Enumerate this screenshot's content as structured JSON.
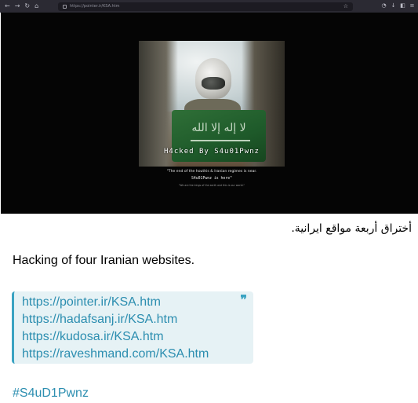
{
  "browser": {
    "url": "https://pointer.ir/KSA.htm",
    "icons": [
      "back-icon",
      "forward-icon",
      "reload-icon",
      "home-icon",
      "bookmark-star-icon",
      "extensions-icon",
      "menu-icon"
    ]
  },
  "screenshot": {
    "hero_text": "H4cked By S4u01Pwnz",
    "caption_line1": "\"The end of the houthis & Iranian regimes is near.",
    "caption_line2": "S4u01Pwnz is here\"",
    "caption_line3": "\"We are the kings of the earth and this is our world.\""
  },
  "message": {
    "arabic_text": "أختراق أربعة مواقع ايرانية.",
    "english_text": "Hacking of four Iranian websites.",
    "quote_links": [
      "https://pointer.ir/KSA.htm",
      "https://hadafsanj.ir/KSA.htm",
      "https://kudosa.ir/KSA.htm",
      "https://raveshmand.com/KSA.htm"
    ],
    "quote_mark": "❞",
    "hashtag": "#S4uD1Pwnz"
  },
  "colors": {
    "link": "#2c8eb0",
    "quote_bg": "#e6f2f5",
    "quote_border": "#3aa3c2"
  }
}
